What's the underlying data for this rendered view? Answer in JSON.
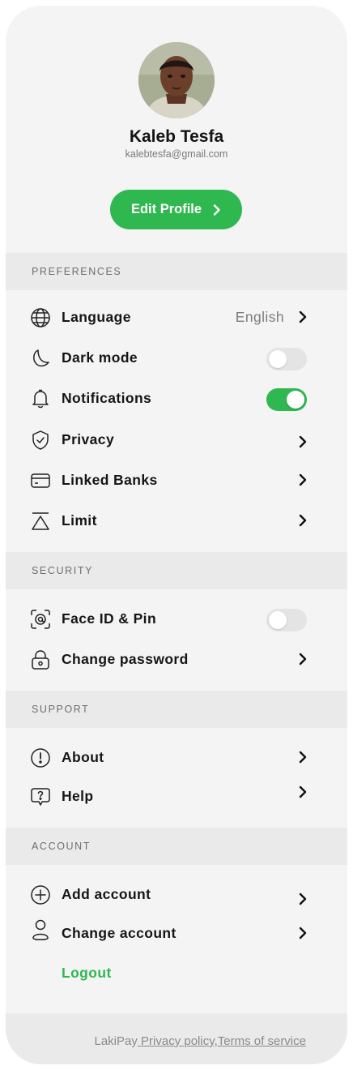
{
  "profile": {
    "name": "Kaleb Tesfa",
    "email": "kalebtesfa@gmail.com",
    "edit_label": "Edit Profile"
  },
  "sections": {
    "preferences": "PREFERENCES",
    "security": "SECURITY",
    "support": "SUPPORT",
    "account": "ACCOUNT"
  },
  "preferences": {
    "language": {
      "label": "Language",
      "value": "English",
      "icon": "globe-icon"
    },
    "dark_mode": {
      "label": "Dark mode",
      "icon": "moon-icon",
      "enabled": false
    },
    "notifications": {
      "label": "Notifications",
      "icon": "bell-icon",
      "enabled": true
    },
    "privacy": {
      "label": "Privacy",
      "icon": "shield-check-icon"
    },
    "linked_banks": {
      "label": "Linked Banks",
      "icon": "card-icon"
    },
    "limit": {
      "label": "Limit",
      "icon": "limit-triangle-icon"
    }
  },
  "security": {
    "face_id": {
      "label": "Face ID & Pin",
      "icon": "face-id-icon",
      "enabled": false
    },
    "change_password": {
      "label": "Change password",
      "icon": "lock-icon"
    }
  },
  "support": {
    "about": {
      "label": "About",
      "icon": "info-icon"
    },
    "help": {
      "label": "Help",
      "icon": "help-bubble-icon"
    }
  },
  "account": {
    "add_account": {
      "label": "Add account",
      "icon": "plus-circle-icon"
    },
    "change_account": {
      "label": "Change account",
      "icon": "user-icon"
    },
    "logout": "Logout"
  },
  "footer": {
    "brand": "LakiPay",
    "privacy": "Privacy policy",
    "separator": ",",
    "terms": "Terms of service"
  },
  "colors": {
    "accent": "#2fb84f",
    "background": "#f3f4f3",
    "section_bg": "#e9eae9",
    "toggle_off": "#e4e4e4"
  }
}
